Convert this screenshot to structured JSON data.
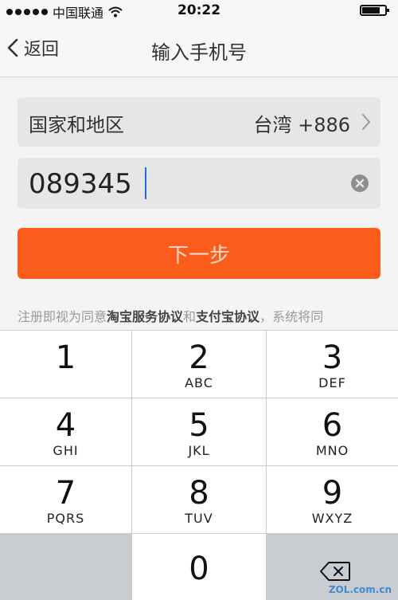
{
  "status_bar": {
    "carrier": "中国联通",
    "time": "20:22"
  },
  "nav": {
    "back_label": "返回",
    "title": "输入手机号"
  },
  "region": {
    "label": "国家和地区",
    "value": "台湾 +886"
  },
  "phone": {
    "value": "089345"
  },
  "next_button": {
    "label": "下一步"
  },
  "agreement": {
    "prefix": "注册即视为同意",
    "link1": "淘宝服务协议",
    "and": "和",
    "link2": "支付宝协议",
    "suffix": "，系统将同"
  },
  "keypad": {
    "keys": [
      {
        "digit": "1",
        "letters": ""
      },
      {
        "digit": "2",
        "letters": "ABC"
      },
      {
        "digit": "3",
        "letters": "DEF"
      },
      {
        "digit": "4",
        "letters": "GHI"
      },
      {
        "digit": "5",
        "letters": "JKL"
      },
      {
        "digit": "6",
        "letters": "MNO"
      },
      {
        "digit": "7",
        "letters": "PQRS"
      },
      {
        "digit": "8",
        "letters": "TUV"
      },
      {
        "digit": "9",
        "letters": "WXYZ"
      },
      {
        "digit": "0",
        "letters": ""
      }
    ]
  },
  "watermark": "ZOL.com.cn",
  "icons": {
    "back": "chevron-left-icon",
    "region_more": "chevron-right-icon",
    "clear": "clear-icon",
    "delete": "backspace-icon",
    "wifi": "wifi-icon",
    "battery": "battery-icon"
  },
  "colors": {
    "accent": "#fb5c1c",
    "keypad_bg": "#c8cbd0",
    "field_bg": "#e6e6e6"
  }
}
